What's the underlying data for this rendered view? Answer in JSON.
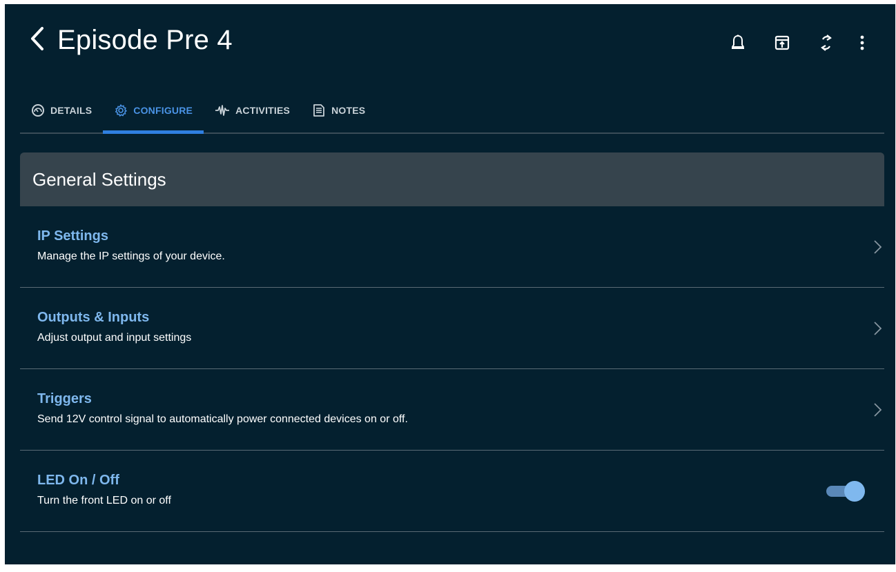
{
  "header": {
    "title": "Episode Pre 4",
    "back_icon": "chevron-left-icon",
    "actions": [
      {
        "name": "notifications",
        "icon": "bell-icon"
      },
      {
        "name": "export",
        "icon": "upload-box-icon"
      },
      {
        "name": "refresh",
        "icon": "sync-icon"
      },
      {
        "name": "more",
        "icon": "kebab-icon"
      }
    ]
  },
  "tabs": [
    {
      "label": "DETAILS",
      "icon": "gauge-icon",
      "active": false
    },
    {
      "label": "CONFIGURE",
      "icon": "gear-icon",
      "active": true
    },
    {
      "label": "ACTIVITIES",
      "icon": "pulse-icon",
      "active": false
    },
    {
      "label": "NOTES",
      "icon": "document-icon",
      "active": false
    }
  ],
  "section": {
    "title": "General Settings",
    "items": [
      {
        "title": "IP Settings",
        "description": "Manage the IP settings of your device.",
        "control": "chevron"
      },
      {
        "title": "Outputs & Inputs",
        "description": "Adjust output and input settings",
        "control": "chevron"
      },
      {
        "title": "Triggers",
        "description": "Send 12V control signal to automatically power connected devices on or off.",
        "control": "chevron"
      },
      {
        "title": "LED On / Off",
        "description": "Turn the front LED on or off",
        "control": "toggle",
        "toggle_on": true
      }
    ]
  },
  "colors": {
    "background": "#04202f",
    "accent": "#2f7fe0",
    "item_title": "#7fb8ee",
    "section_header_bg": "#36444d"
  }
}
